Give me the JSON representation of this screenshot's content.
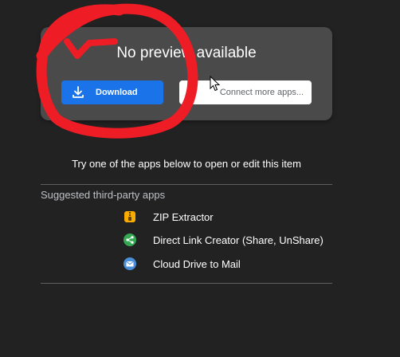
{
  "preview": {
    "title": "No preview available",
    "download_label": "Download",
    "connect_label": "Connect more apps..."
  },
  "prompt": "Try one of the apps below to open or edit this item",
  "suggested": {
    "title": "Suggested third-party apps",
    "apps": [
      {
        "label": "ZIP Extractor",
        "icon": "zip-extractor-icon",
        "color": "#f9ab00"
      },
      {
        "label": "Direct Link Creator (Share, UnShare)",
        "icon": "share-icon",
        "color": "#34a853"
      },
      {
        "label": "Cloud Drive to Mail",
        "icon": "mail-icon",
        "color": "#4a90d9"
      }
    ]
  },
  "colors": {
    "background": "#222222",
    "card": "#4a4a4a",
    "accent": "#1a73e8",
    "annotation": "#ee1c25"
  }
}
